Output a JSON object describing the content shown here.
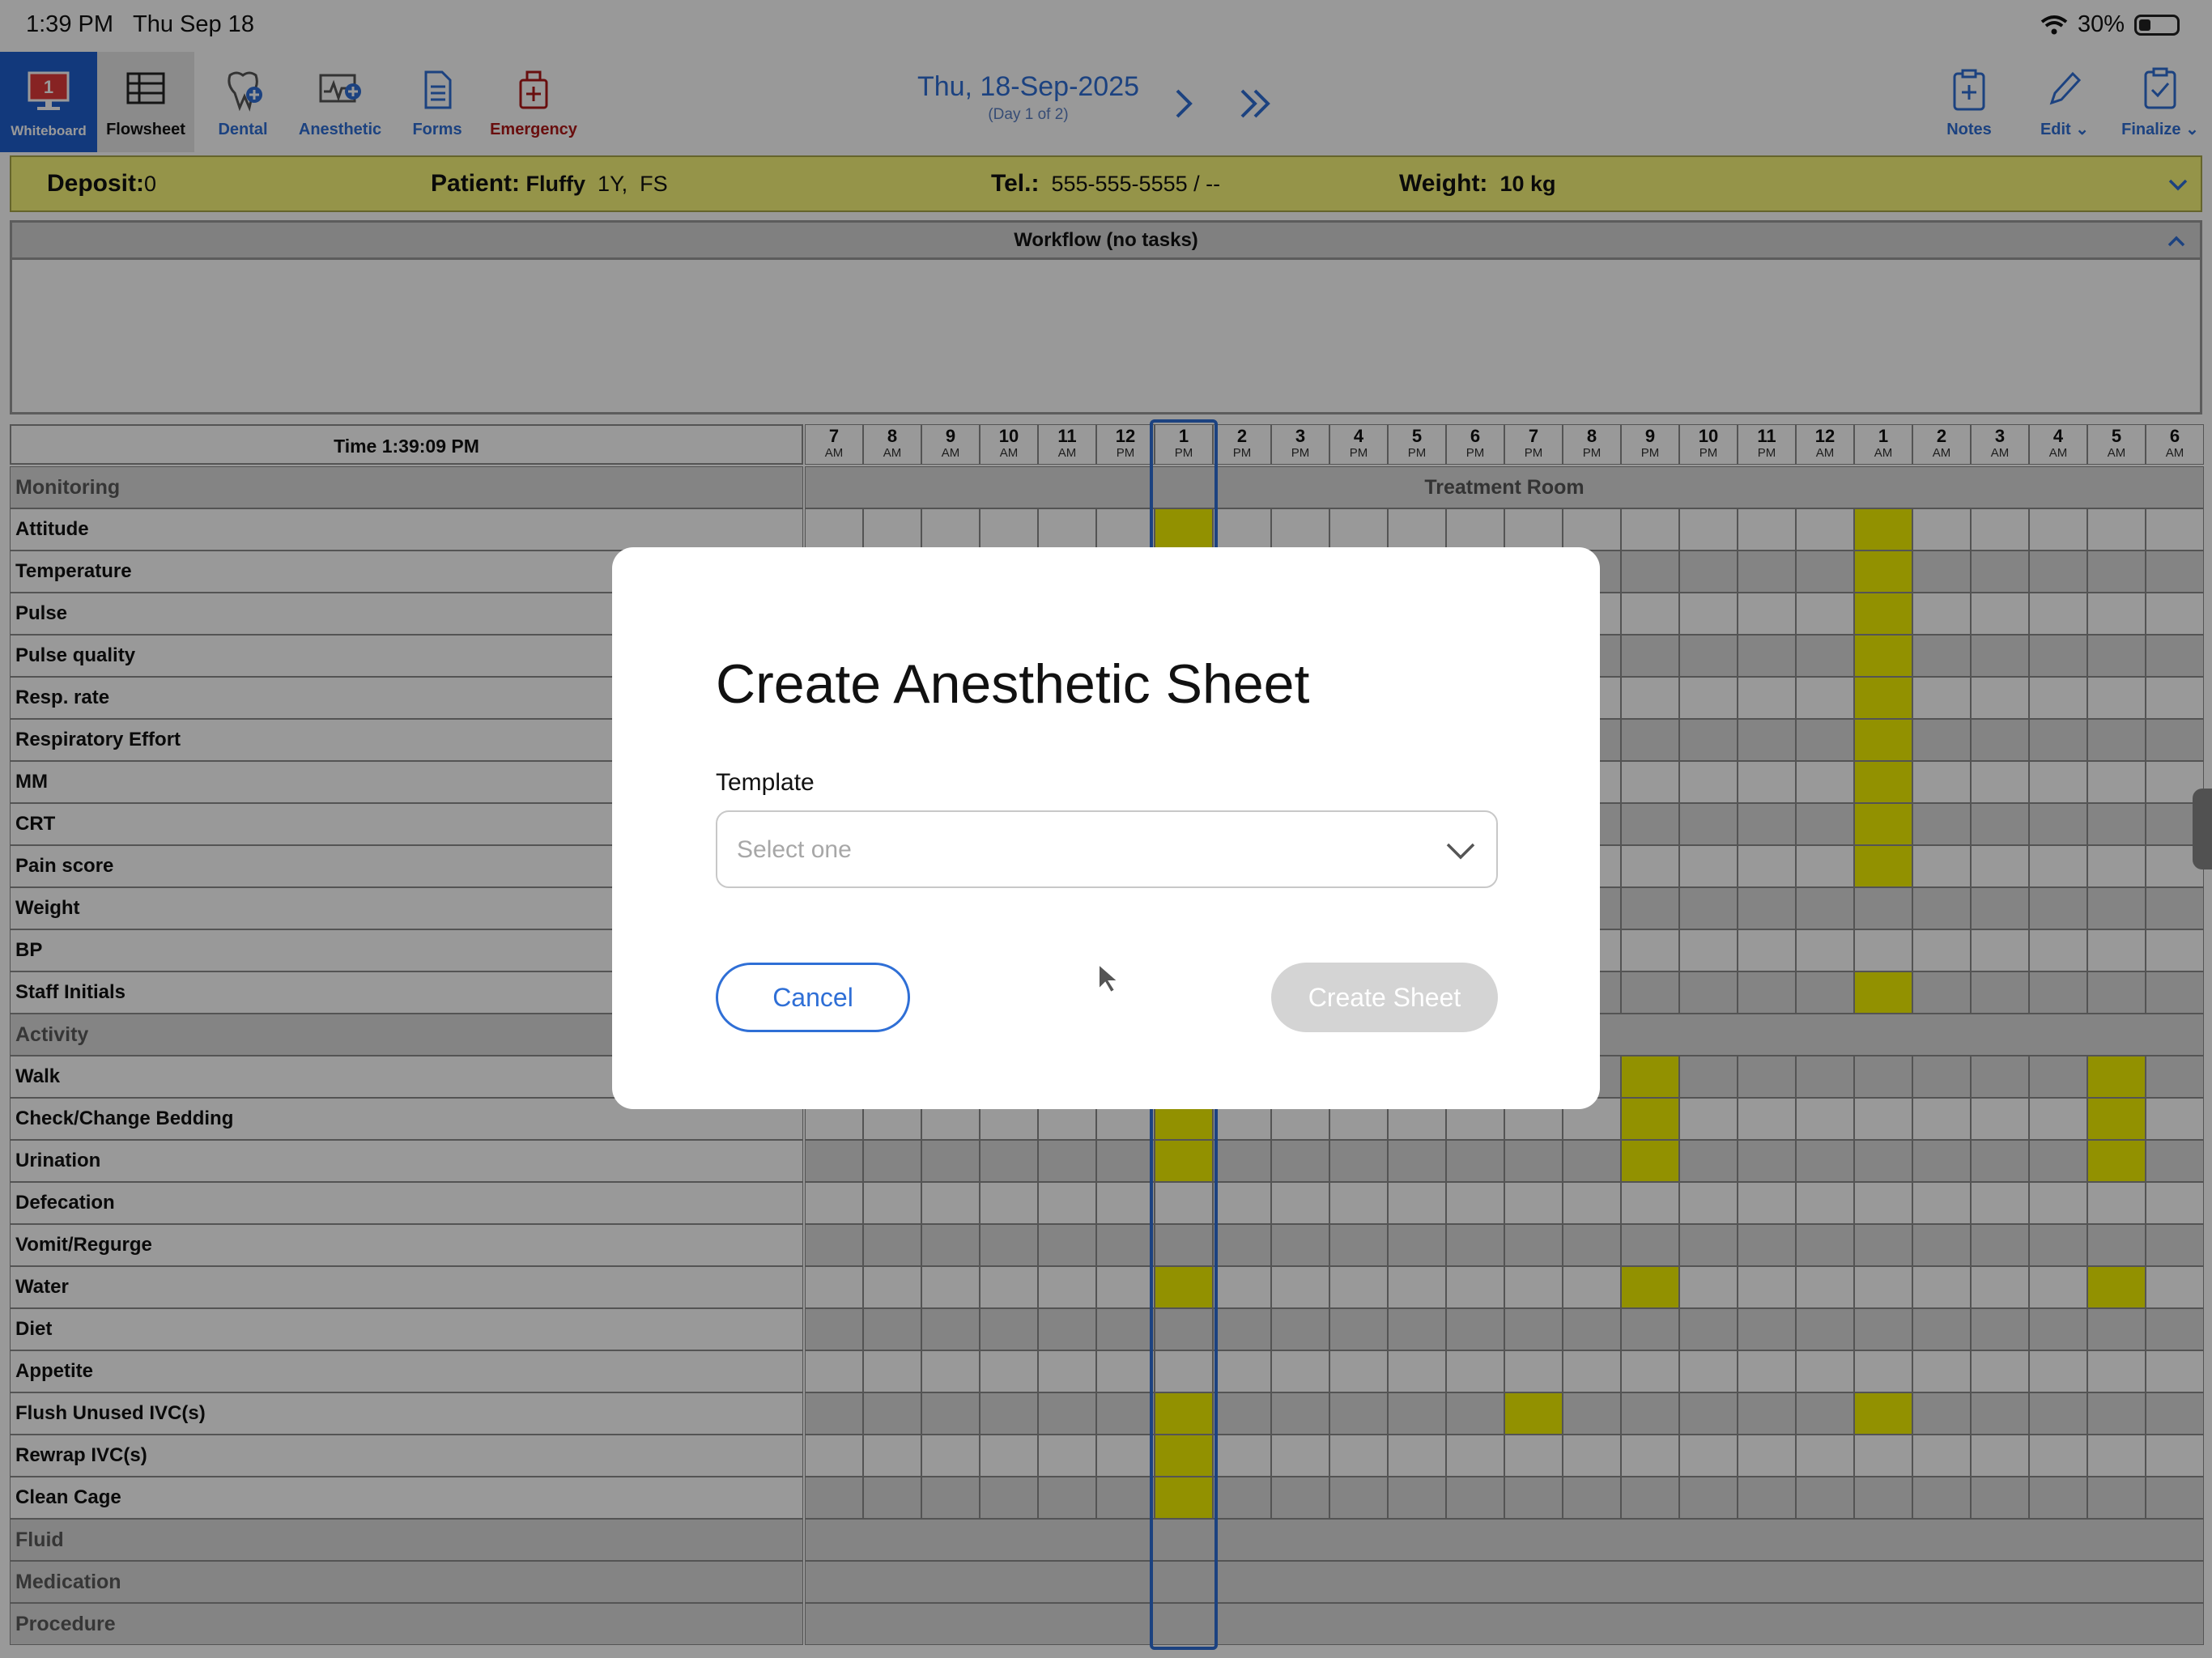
{
  "status_bar": {
    "time": "1:39 PM",
    "date": "Thu Sep 18",
    "battery": "30%"
  },
  "toolbar": {
    "whiteboard": {
      "label": "Whiteboard",
      "badge": "1"
    },
    "flowsheet": "Flowsheet",
    "dental": "Dental",
    "anesthetic": "Anesthetic",
    "forms": "Forms",
    "emergency": "Emergency",
    "notes": "Notes",
    "edit": "Edit",
    "finalize": "Finalize"
  },
  "date_nav": {
    "date": "Thu, 18-Sep-2025",
    "subtitle": "(Day 1 of 2)"
  },
  "patient_bar": {
    "deposit_label": "Deposit:",
    "deposit_value": "0",
    "patient_label": "Patient:",
    "patient_name": "Fluffy",
    "patient_age": "1Y,",
    "patient_sex": "FS",
    "tel_label": "Tel.:",
    "tel_value": "555-555-5555 / --",
    "weight_label": "Weight:",
    "weight_value": "10 kg"
  },
  "workflow": {
    "title": "Workflow (no tasks)"
  },
  "grid": {
    "time_header": "Time 1:39:09 PM",
    "hours": [
      {
        "n": "7",
        "p": "AM"
      },
      {
        "n": "8",
        "p": "AM"
      },
      {
        "n": "9",
        "p": "AM"
      },
      {
        "n": "10",
        "p": "AM"
      },
      {
        "n": "11",
        "p": "AM"
      },
      {
        "n": "12",
        "p": "PM"
      },
      {
        "n": "1",
        "p": "PM"
      },
      {
        "n": "2",
        "p": "PM"
      },
      {
        "n": "3",
        "p": "PM"
      },
      {
        "n": "4",
        "p": "PM"
      },
      {
        "n": "5",
        "p": "PM"
      },
      {
        "n": "6",
        "p": "PM"
      },
      {
        "n": "7",
        "p": "PM"
      },
      {
        "n": "8",
        "p": "PM"
      },
      {
        "n": "9",
        "p": "PM"
      },
      {
        "n": "10",
        "p": "PM"
      },
      {
        "n": "11",
        "p": "PM"
      },
      {
        "n": "12",
        "p": "AM"
      },
      {
        "n": "1",
        "p": "AM"
      },
      {
        "n": "2",
        "p": "AM"
      },
      {
        "n": "3",
        "p": "AM"
      },
      {
        "n": "4",
        "p": "AM"
      },
      {
        "n": "5",
        "p": "AM"
      },
      {
        "n": "6",
        "p": "AM"
      }
    ],
    "location_label": "Treatment Room",
    "rows": [
      {
        "label": "Monitoring",
        "section": true
      },
      {
        "label": "Attitude",
        "hl": [
          6,
          18
        ]
      },
      {
        "label": "Temperature",
        "hl": [
          6,
          18
        ]
      },
      {
        "label": "Pulse",
        "hl": [
          6,
          18
        ]
      },
      {
        "label": "Pulse quality",
        "hl": [
          6,
          18
        ]
      },
      {
        "label": "Resp. rate",
        "hl": [
          6,
          18
        ]
      },
      {
        "label": "Respiratory Effort",
        "hl": [
          6,
          18
        ]
      },
      {
        "label": "MM",
        "hl": [
          6,
          18
        ]
      },
      {
        "label": "CRT",
        "hl": [
          6,
          18
        ]
      },
      {
        "label": "Pain score",
        "hl": [
          6,
          18
        ]
      },
      {
        "label": "Weight",
        "hl": []
      },
      {
        "label": "BP",
        "hl": []
      },
      {
        "label": "Staff Initials",
        "hl": [
          6,
          18
        ]
      },
      {
        "label": "Activity",
        "section": true
      },
      {
        "label": "Walk",
        "hl": [
          6,
          14,
          22
        ]
      },
      {
        "label": "Check/Change Bedding",
        "hl": [
          6,
          14,
          22
        ]
      },
      {
        "label": "Urination",
        "hl": [
          6,
          14,
          22
        ]
      },
      {
        "label": "Defecation",
        "hl": []
      },
      {
        "label": "Vomit/Regurge",
        "hl": []
      },
      {
        "label": "Water",
        "hl": [
          6,
          14,
          22
        ]
      },
      {
        "label": "Diet",
        "hl": []
      },
      {
        "label": "Appetite",
        "hl": []
      },
      {
        "label": "Flush Unused IVC(s)",
        "hl": [
          6,
          12,
          18
        ]
      },
      {
        "label": "Rewrap IVC(s)",
        "hl": [
          6
        ]
      },
      {
        "label": "Clean Cage",
        "hl": [
          6
        ]
      },
      {
        "label": "Fluid",
        "section": true
      },
      {
        "label": "Medication",
        "section": true
      },
      {
        "label": "Procedure",
        "section": true
      }
    ]
  },
  "dialog": {
    "title": "Create Anesthetic Sheet",
    "template_label": "Template",
    "template_placeholder": "Select one",
    "cancel": "Cancel",
    "create": "Create Sheet"
  }
}
